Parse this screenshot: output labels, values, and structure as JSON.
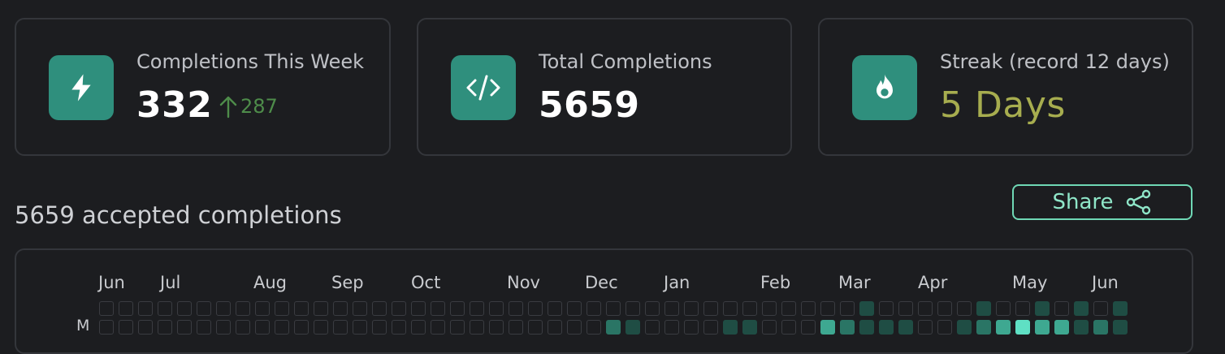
{
  "cards": [
    {
      "label": "Completions This Week",
      "value": "332",
      "delta": "287",
      "icon": "lightning-bolt-icon"
    },
    {
      "label": "Total Completions",
      "value": "5659",
      "icon": "code-icon"
    },
    {
      "label": "Streak (record 12 days)",
      "value": "5 Days",
      "icon": "flame-icon"
    }
  ],
  "section_title": "5659 accepted completions",
  "share_label": "Share",
  "heatmap": {
    "months": [
      "Jun",
      "Jul",
      "Aug",
      "Sep",
      "Oct",
      "Nov",
      "Dec",
      "Jan",
      "Feb",
      "Mar",
      "Apr",
      "May",
      "Jun"
    ],
    "day_label": "M",
    "row0": [
      0,
      0,
      0,
      0,
      0,
      0,
      0,
      0,
      0,
      0,
      0,
      0,
      0,
      0,
      0,
      0,
      0,
      0,
      0,
      0,
      0,
      0,
      0,
      0,
      0,
      0,
      0,
      0,
      0,
      0,
      0,
      0,
      0,
      0,
      0,
      0,
      0,
      0,
      0,
      1,
      0,
      0,
      0,
      0,
      0,
      1,
      0,
      0,
      1,
      0,
      1,
      0,
      1
    ],
    "row1": [
      0,
      0,
      0,
      0,
      0,
      0,
      0,
      0,
      0,
      0,
      0,
      0,
      0,
      0,
      0,
      0,
      0,
      0,
      0,
      0,
      0,
      0,
      0,
      0,
      0,
      0,
      2,
      1,
      0,
      0,
      0,
      0,
      1,
      1,
      0,
      0,
      0,
      3,
      2,
      1,
      1,
      1,
      0,
      0,
      1,
      2,
      3,
      4,
      3,
      3,
      1,
      2,
      1
    ]
  },
  "colors": {
    "accent": "#2f8f7d",
    "streak": "#a7ad4f",
    "delta": "#4e8c4a",
    "share": "#8fe6c8",
    "cell_levels": [
      "#24262a",
      "#1f4d44",
      "#2a7565",
      "#3ea891",
      "#5fe0c4"
    ]
  }
}
